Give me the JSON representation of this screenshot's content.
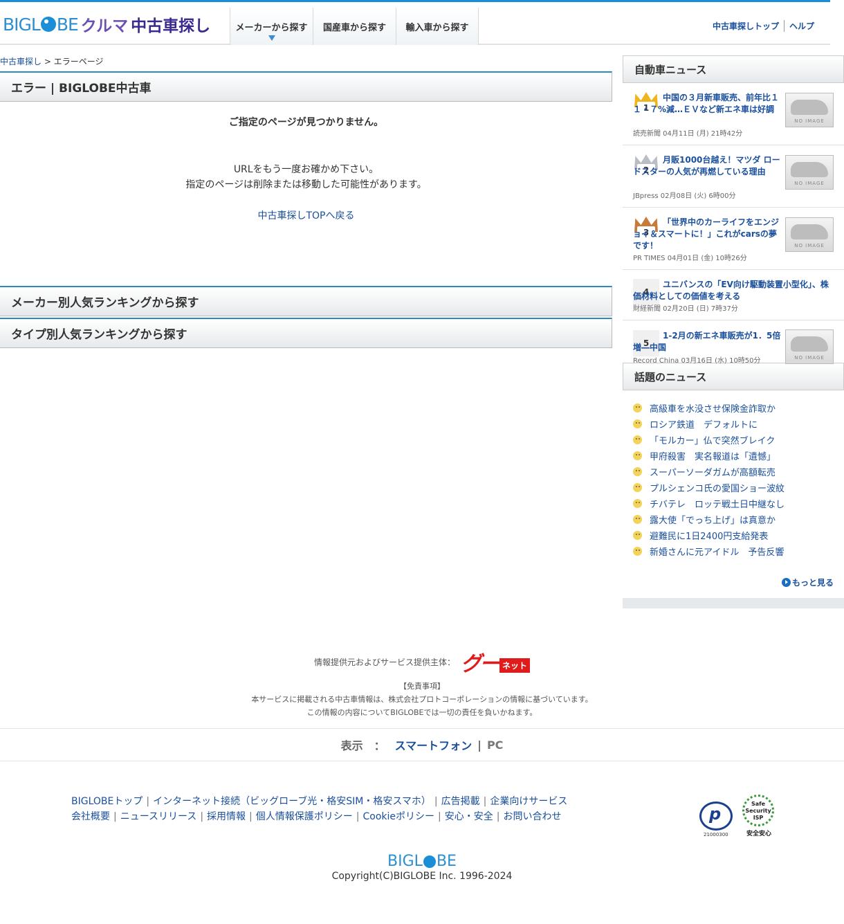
{
  "header": {
    "logo_big_1": "BIGL",
    "logo_big_2": "BE",
    "logo_kuruma": "クルマ",
    "logo_usedcar": "中古車探し",
    "nav": [
      "メーカーから探す",
      "国産車から探す",
      "輸入車から探す"
    ],
    "links": [
      "中古車探しトップ",
      "ヘルプ"
    ]
  },
  "breadcrumb": {
    "home": "中古車探し",
    "sep": " > ",
    "current": "エラーページ"
  },
  "main": {
    "title": "エラー | BIGLOBE中古車",
    "msg1": "ご指定のページが見つかりません。",
    "msg2_line1": "URLをもう一度お確かめ下さい。",
    "msg2_line2": "指定のページは削除または移動した可能性があります。",
    "top_link": "中古車探しTOPへ戻る",
    "maker_ranking": "メーカー別人気ランキングから探す",
    "type_ranking": "タイプ別人気ランキングから探す"
  },
  "sidebar": {
    "car_news_title": "自動車ニュース",
    "news": [
      {
        "rank": "1",
        "title": "中国の３月新車販売、前年比１１・７%減…ＥＶなど新エネ車は好調",
        "meta": "読売新聞 04月11日 (月) 21時42分",
        "noimg": "NO IMAGE"
      },
      {
        "rank": "2",
        "title": "月販1000台越え！マツダ ロードスターの人気が再燃している理由",
        "meta": "JBpress 02月08日 (火) 6時00分",
        "noimg": "NO IMAGE"
      },
      {
        "rank": "3",
        "title": "「世界中のカーライフをエンジョイ＆スマートに！」これがcarsの夢です！",
        "meta": "PR TIMES 04月01日 (金) 10時26分",
        "noimg": "NO IMAGE"
      },
      {
        "rank": "4",
        "title": "ユニバンスの「EV向け駆動装置小型化」、株価材料としての価値を考える",
        "meta": "財経新聞 02月20日 (日) 7時37分"
      },
      {
        "rank": "5",
        "title": "1-2月の新エネ車販売が1．5倍増―中国",
        "meta": "Record China 03月16日 (水) 10時50分",
        "noimg": "NO IMAGE"
      }
    ],
    "topics_title": "話題のニュース",
    "topics": [
      "高級車を水没させ保険金詐取か",
      "ロシア鉄道　デフォルトに",
      "「モルカー」仏で突然ブレイク",
      "甲府殺害　実名報道は「遺憾」",
      "スーパーソーダガムが高額転売",
      "プルシェンコ氏の愛国ショー波紋",
      "チバテレ　ロッテ戦土日中継なし",
      "露大使「でっち上げ」は真意か",
      "避難民に1日2400円支給発表",
      "新婚さんに元アイドル　予告反響"
    ],
    "more": "もっと見る"
  },
  "footer": {
    "provider": "情報提供元およびサービス提供主体：",
    "goo_logo": "グー",
    "goo_net": "ネット",
    "disclaimer_title": "【免責事項】",
    "disclaimer_1": "本サービスに掲載される中古車情報は、株式会社プロトコーポレーションの情報に基づいています。",
    "disclaimer_2": "この情報の内容についてBIGLOBEでは一切の責任を負いかねます。",
    "view_label": "表示　：",
    "view_sp": "スマートフォン",
    "view_sep": "|",
    "view_pc": "PC",
    "links_row1": [
      "BIGLOBEトップ",
      "インターネット接続（ビッグローブ光・格安SIM・格安スマホ）",
      "広告掲載",
      "企業向けサービス"
    ],
    "links_row2": [
      "会社概要",
      "ニュースリリース",
      "採用情報",
      "個人情報保護ポリシー",
      "Cookieポリシー",
      "安心・安全",
      "お問い合わせ"
    ],
    "privacy_num": "21000300",
    "safe_isp": "Safe Security ISP",
    "safe_sub": "安全安心",
    "logo_1": "BIGL",
    "logo_2": "BE",
    "copyright": "Copyright(C)BIGLOBE Inc. 1996-2024"
  },
  "colors": {
    "accent": "#1a8ed6",
    "link": "#1a4f9c",
    "brand_purple": "#6a4fb4"
  }
}
